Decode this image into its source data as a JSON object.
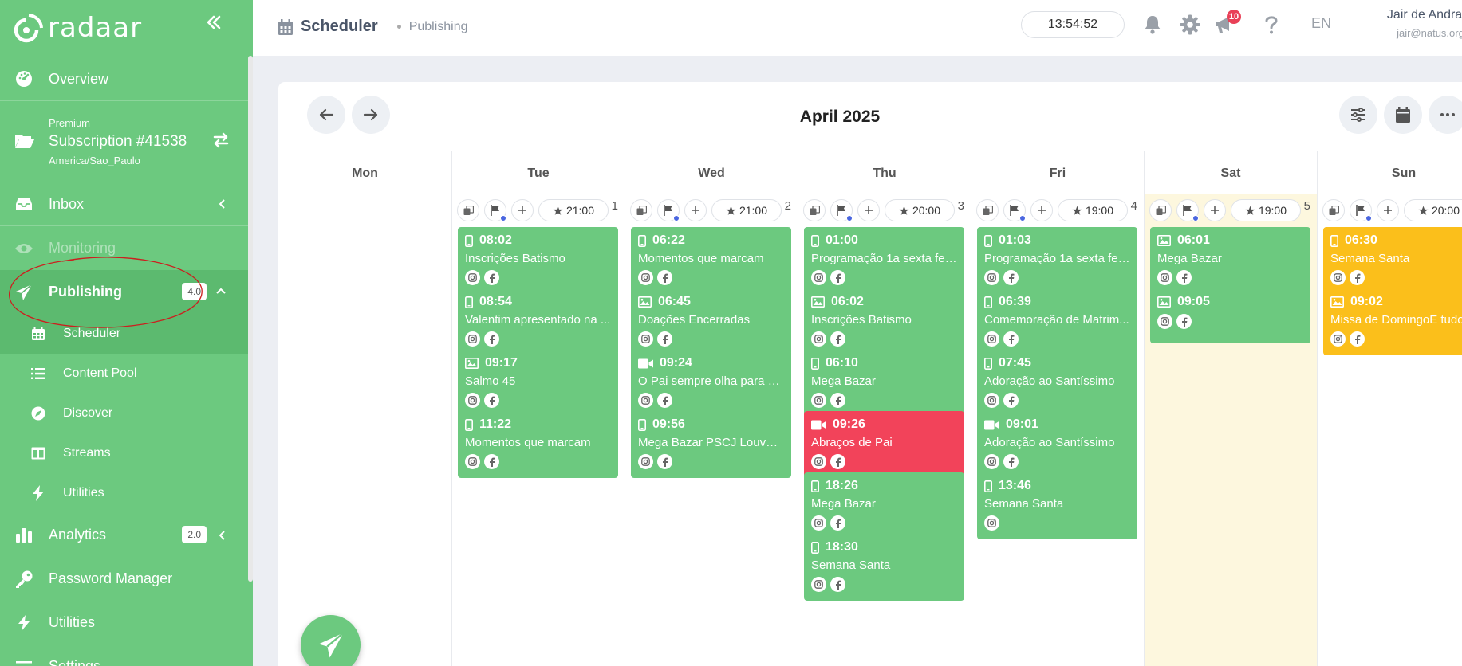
{
  "brand": {
    "name": "radaar"
  },
  "sidebar": {
    "overview": "Overview",
    "subscription": {
      "tier": "Premium",
      "name": "Subscription #41538",
      "timezone": "America/Sao_Paulo"
    },
    "inbox": "Inbox",
    "monitoring": "Monitoring",
    "publishing": {
      "label": "Publishing",
      "badge": "4.0"
    },
    "sub": {
      "scheduler": "Scheduler",
      "content_pool": "Content Pool",
      "discover": "Discover",
      "streams": "Streams",
      "utilities": "Utilities"
    },
    "analytics": {
      "label": "Analytics",
      "badge": "2.0"
    },
    "password_manager": "Password Manager",
    "utilities": "Utilities",
    "settings": "Settings"
  },
  "header": {
    "title": "Scheduler",
    "breadcrumb": "Publishing",
    "clock": "13:54:52",
    "notifications": "10",
    "lang": "EN",
    "user_name": "Jair de Andrade",
    "user_email": "jair@natus.org.br"
  },
  "calendar": {
    "month": "April 2025",
    "days": [
      {
        "name": "Mon",
        "num": "",
        "best": "",
        "weekend": false,
        "posts": []
      },
      {
        "name": "Tue",
        "num": "1",
        "best": "21:00",
        "weekend": false,
        "posts": [
          {
            "time": "08:02",
            "title": "Inscrições Batismo",
            "type": "mobile",
            "color": "green",
            "socials": [
              "instagram",
              "facebook"
            ]
          },
          {
            "time": "08:54",
            "title": "Valentim apresentado na ...",
            "type": "mobile",
            "color": "green",
            "socials": [
              "instagram",
              "facebook"
            ]
          },
          {
            "time": "09:17",
            "title": "Salmo 45",
            "type": "image",
            "color": "green",
            "socials": [
              "instagram",
              "facebook"
            ]
          },
          {
            "time": "11:22",
            "title": "Momentos que marcam",
            "type": "mobile",
            "color": "green",
            "socials": [
              "instagram",
              "facebook"
            ]
          }
        ]
      },
      {
        "name": "Wed",
        "num": "2",
        "best": "21:00",
        "weekend": false,
        "posts": [
          {
            "time": "06:22",
            "title": "Momentos que marcam",
            "type": "mobile",
            "color": "green",
            "socials": [
              "instagram",
              "facebook"
            ]
          },
          {
            "time": "06:45",
            "title": "Doações Encerradas",
            "type": "image",
            "color": "green",
            "socials": [
              "instagram",
              "facebook"
            ]
          },
          {
            "time": "09:24",
            "title": "O Pai sempre olha para n...",
            "type": "video",
            "color": "green",
            "socials": [
              "instagram",
              "facebook"
            ]
          },
          {
            "time": "09:56",
            "title": "Mega Bazar PSCJ Louveira",
            "type": "mobile",
            "color": "green",
            "socials": [
              "instagram",
              "facebook"
            ]
          }
        ]
      },
      {
        "name": "Thu",
        "num": "3",
        "best": "20:00",
        "weekend": false,
        "posts": [
          {
            "time": "01:00",
            "title": "Programação 1a sexta fei...",
            "type": "mobile",
            "color": "green",
            "socials": [
              "instagram",
              "facebook"
            ]
          },
          {
            "time": "06:02",
            "title": "Inscrições Batismo",
            "type": "image",
            "color": "green",
            "socials": [
              "instagram",
              "facebook"
            ]
          },
          {
            "time": "06:10",
            "title": "Mega Bazar",
            "type": "mobile",
            "color": "green",
            "socials": [
              "instagram",
              "facebook"
            ]
          },
          {
            "time": "09:26",
            "title": "Abraços de Pai",
            "type": "video",
            "color": "red",
            "socials": [
              "instagram",
              "facebook"
            ]
          },
          {
            "time": "18:26",
            "title": "Mega Bazar",
            "type": "mobile",
            "color": "green",
            "socials": [
              "instagram",
              "facebook"
            ]
          },
          {
            "time": "18:30",
            "title": "Semana Santa",
            "type": "mobile",
            "color": "green",
            "socials": [
              "instagram",
              "facebook"
            ]
          }
        ]
      },
      {
        "name": "Fri",
        "num": "4",
        "best": "19:00",
        "weekend": false,
        "posts": [
          {
            "time": "01:03",
            "title": "Programação 1a sexta fei...",
            "type": "mobile",
            "color": "green",
            "socials": [
              "instagram",
              "facebook"
            ]
          },
          {
            "time": "06:39",
            "title": "Comemoração de Matrim...",
            "type": "mobile",
            "color": "green",
            "socials": [
              "instagram",
              "facebook"
            ]
          },
          {
            "time": "07:45",
            "title": "Adoração ao Santíssimo",
            "type": "mobile",
            "color": "green",
            "socials": [
              "instagram",
              "facebook"
            ]
          },
          {
            "time": "09:01",
            "title": "Adoração ao Santíssimo",
            "type": "video",
            "color": "green",
            "socials": [
              "instagram",
              "facebook"
            ]
          },
          {
            "time": "13:46",
            "title": "Semana Santa",
            "type": "mobile",
            "color": "green",
            "socials": [
              "instagram"
            ]
          }
        ]
      },
      {
        "name": "Sat",
        "num": "5",
        "best": "19:00",
        "weekend": true,
        "posts": [
          {
            "time": "06:01",
            "title": "Mega Bazar",
            "type": "image",
            "color": "green",
            "socials": [
              "instagram",
              "facebook"
            ]
          },
          {
            "time": "09:05",
            "title": "",
            "type": "image",
            "color": "green",
            "socials": [
              "instagram",
              "facebook"
            ]
          }
        ]
      },
      {
        "name": "Sun",
        "num": "",
        "best": "20:00",
        "weekend": false,
        "posts": [
          {
            "time": "06:30",
            "title": "Semana Santa",
            "type": "mobile",
            "color": "yellow",
            "socials": [
              "instagram",
              "facebook"
            ]
          },
          {
            "time": "09:02",
            "title": "Missa de DomingoE tudo",
            "type": "image",
            "color": "yellow",
            "socials": [
              "instagram",
              "facebook"
            ]
          }
        ]
      }
    ]
  }
}
